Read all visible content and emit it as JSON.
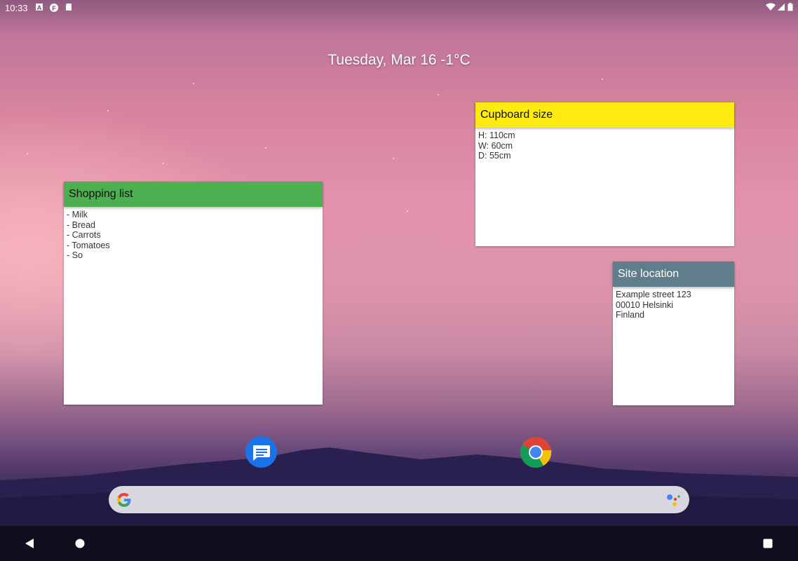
{
  "status_bar": {
    "time": "10:33",
    "left_icons": [
      "font-a-icon",
      "app-f-icon",
      "sd-card-icon"
    ],
    "right_icons": [
      "wifi-icon",
      "signal-icon",
      "battery-icon"
    ]
  },
  "header": {
    "date_weather": "Tuesday, Mar 16 -1°C"
  },
  "notes": {
    "shopping": {
      "title": "Shopping list",
      "body": "- Milk\n- Bread\n- Carrots\n- Tomatoes\n- So",
      "color": "#4caf50"
    },
    "cupboard": {
      "title": "Cupboard size",
      "body": "H: 110cm\nW: 60cm\nD: 55cm",
      "color": "#ffeb0f"
    },
    "site": {
      "title": "Site location",
      "body": "Example street 123\n00010 Helsinki\nFinland",
      "color": "#607d8b"
    }
  },
  "dock": {
    "apps": [
      "messages-icon",
      "chrome-icon"
    ]
  },
  "search": {
    "logo": "google-g-icon",
    "assistant": "google-assistant-icon"
  },
  "nav": {
    "back": "back-icon",
    "home": "home-icon",
    "recents": "recents-icon"
  }
}
